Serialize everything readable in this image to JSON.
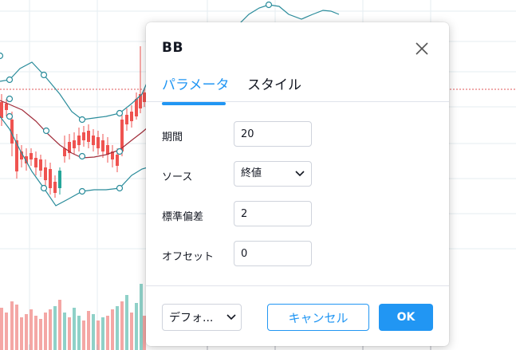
{
  "colors": {
    "accent": "#2196f3",
    "band_line": "#2a8c9b",
    "basis_line": "#a12d3a",
    "candle_up": "#26a69a",
    "candle_down": "#ef5350",
    "vol_up": "#8fd1c8",
    "vol_down": "#f4a7a5"
  },
  "dialog": {
    "title": "BB",
    "close_icon": "close-x-icon",
    "tabs": [
      {
        "label": "パラメータ",
        "active": true
      },
      {
        "label": "スタイル",
        "active": false
      }
    ],
    "params": {
      "length": {
        "label": "期間",
        "value": "20"
      },
      "source": {
        "label": "ソース",
        "value": "終値"
      },
      "stddev": {
        "label": "標準偏差",
        "value": "2"
      },
      "offset": {
        "label": "オフセット",
        "value": "0"
      }
    },
    "footer": {
      "preset_label": "デフォ...",
      "cancel_label": "キャンセル",
      "ok_label": "OK"
    }
  }
}
